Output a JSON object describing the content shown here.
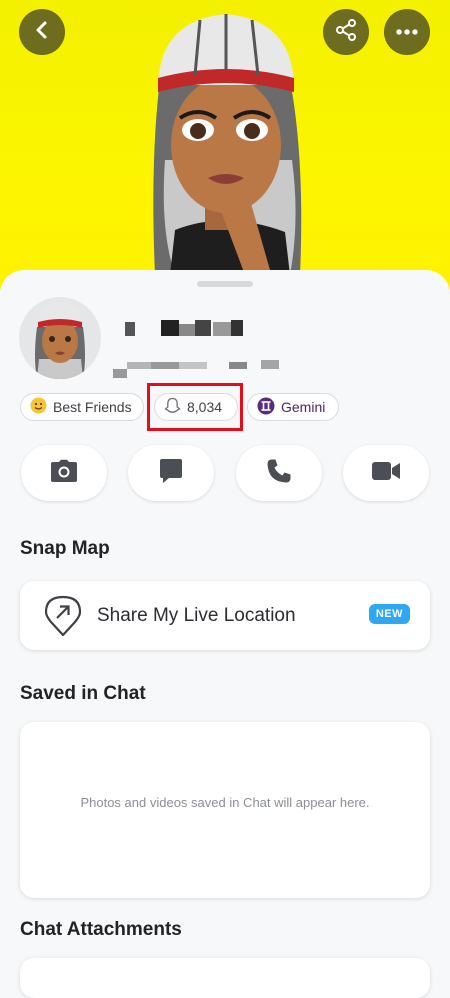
{
  "header": {
    "back_icon": "chevron-left-icon",
    "share_icon": "share-icon",
    "more_icon": "more-horizontal-icon"
  },
  "profile": {
    "chips": [
      {
        "label": "Best Friends",
        "icon": "smile-emoji-icon"
      },
      {
        "label": "8,034",
        "icon": "ghost-score-icon"
      },
      {
        "label": "Gemini",
        "icon": "gemini-zodiac-icon"
      }
    ],
    "actions": [
      "camera-icon",
      "chat-icon",
      "phone-icon",
      "video-icon"
    ]
  },
  "snap_map": {
    "title": "Snap Map",
    "share_label": "Share My Live Location",
    "badge": "NEW"
  },
  "saved": {
    "title": "Saved in Chat",
    "empty_text": "Photos and videos saved in Chat will appear here."
  },
  "attachments": {
    "title": "Chat Attachments"
  },
  "colors": {
    "hero_yellow": "#fff200",
    "badge_blue": "#2ea8f2",
    "highlight_red": "#e20f1a"
  }
}
